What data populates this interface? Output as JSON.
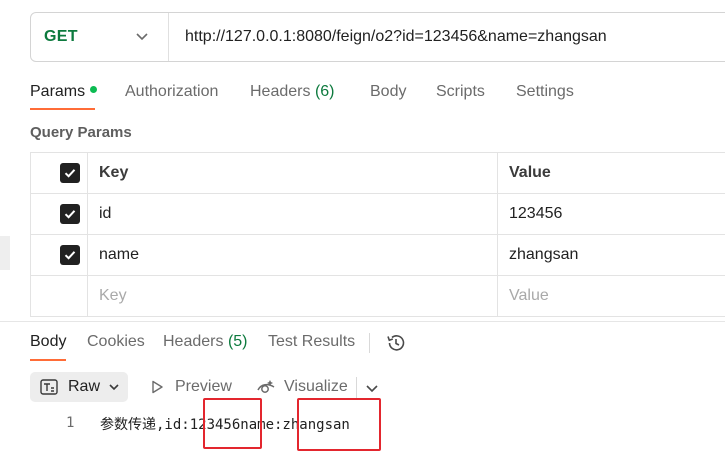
{
  "request": {
    "method": "GET",
    "url": "http://127.0.0.1:8080/feign/o2?id=123456&name=zhangsan"
  },
  "request_tabs": {
    "params": "Params",
    "authorization": "Authorization",
    "headers": "Headers",
    "headers_count": "(6)",
    "body": "Body",
    "scripts": "Scripts",
    "settings": "Settings"
  },
  "query_params": {
    "title": "Query Params",
    "columns": {
      "key": "Key",
      "value": "Value"
    },
    "rows": [
      {
        "checked": true,
        "key": "id",
        "value": "123456"
      },
      {
        "checked": true,
        "key": "name",
        "value": "zhangsan"
      }
    ],
    "placeholder": {
      "key": "Key",
      "value": "Value"
    }
  },
  "response_tabs": {
    "body": "Body",
    "cookies": "Cookies",
    "headers": "Headers",
    "headers_count": "(5)",
    "test_results": "Test Results"
  },
  "response_toolbar": {
    "format": "Raw",
    "preview": "Preview",
    "visualize": "Visualize"
  },
  "response_body": {
    "line_number": "1",
    "text": "参数传递,id:123456name:zhangsan"
  },
  "colors": {
    "accent": "#ff6c37",
    "method_green": "#0d7a3e",
    "status_dot": "#0cbb52",
    "highlight_red": "#e3262e"
  }
}
